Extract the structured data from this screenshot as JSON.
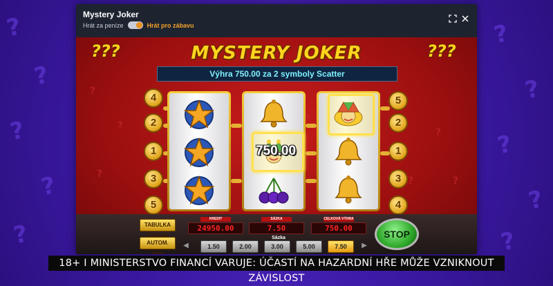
{
  "modal": {
    "title": "Mystery Joker",
    "mode_real": "Hrát za peníze",
    "mode_fun": "Hrát pro zábavu"
  },
  "game": {
    "logo": "MYSTERY JOKER",
    "win_message": "Výhra 750.00 za 2 symboly Scatter",
    "win_amount": "750.00",
    "corner_marks": "???",
    "left_line_numbers": [
      "4",
      "2",
      "1",
      "3",
      "5"
    ],
    "right_line_numbers": [
      "5",
      "2",
      "1",
      "3",
      "4"
    ],
    "reels": [
      [
        "star-icon",
        "star-icon",
        "star-icon"
      ],
      [
        "bell-icon",
        "joker-icon",
        "cherries-icon"
      ],
      [
        "joker-icon",
        "bell-icon",
        "bell-icon"
      ]
    ]
  },
  "controls": {
    "paytable_label": "TABULKA VÝPLAT",
    "autoplay_label": "AUTOM. HRA",
    "credit_label": "KREDIT",
    "credit_value": "24950.00",
    "bet_label": "SÁZKA",
    "bet_value": "7.50",
    "total_win_label": "CELKOVÁ VÝHRA",
    "total_win_value": "750.00",
    "bet_selector_label": "Sázka",
    "bet_options": [
      "1.50",
      "2.00",
      "3.00",
      "5.00",
      "7.50"
    ],
    "selected_bet": "7.50",
    "stop_label": "STOP"
  },
  "warning": "18+ I MINISTERSTVO FINANCÍ VARUJE: ÚČASTÍ NA HAZARDNÍ HŘE MŮŽE VZNIKNOUT ZÁVISLOST",
  "colors": {
    "background": "#3c1aa6",
    "game_red": "#9b0f0f",
    "gold": "#f4cc3a",
    "win_text": "#7ff0ff",
    "meter_text": "#ff2424",
    "fun_mode": "#f2a22b"
  }
}
